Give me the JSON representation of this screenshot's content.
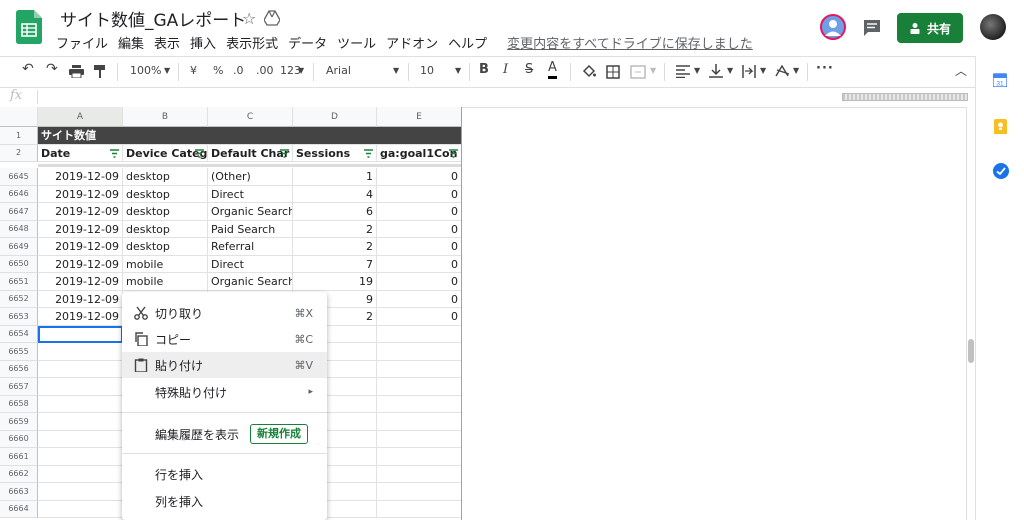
{
  "header": {
    "title": "サイト数値_GAレポート",
    "menu": [
      "ファイル",
      "編集",
      "表示",
      "挿入",
      "表示形式",
      "データ",
      "ツール",
      "アドオン",
      "ヘルプ"
    ],
    "save_status": "変更内容をすべてドライブに保存しました",
    "share_label": "共有",
    "accent_color": "#188038"
  },
  "toolbar": {
    "zoom": "100%",
    "currency": "¥",
    "percent": "%",
    "decimal_decrease": ".0",
    "decimal_increase": ".00",
    "number_format": "123",
    "font": "Arial",
    "font_size": "10"
  },
  "formula": {
    "fx": "fx"
  },
  "sheet": {
    "columns": [
      "A",
      "B",
      "C",
      "D",
      "E"
    ],
    "banner": "サイト数値",
    "headers": [
      "Date",
      "Device Categ",
      "Default Char",
      "Sessions",
      "ga:goal1Con"
    ],
    "header_row_numbers": [
      "1",
      "2"
    ],
    "rows": [
      {
        "n": "6645",
        "date": "2019-12-09",
        "device": "desktop",
        "channel": "(Other)",
        "sessions": "1",
        "goal": "0"
      },
      {
        "n": "6646",
        "date": "2019-12-09",
        "device": "desktop",
        "channel": "Direct",
        "sessions": "4",
        "goal": "0"
      },
      {
        "n": "6647",
        "date": "2019-12-09",
        "device": "desktop",
        "channel": "Organic Search",
        "sessions": "6",
        "goal": "0"
      },
      {
        "n": "6648",
        "date": "2019-12-09",
        "device": "desktop",
        "channel": "Paid Search",
        "sessions": "2",
        "goal": "0"
      },
      {
        "n": "6649",
        "date": "2019-12-09",
        "device": "desktop",
        "channel": "Referral",
        "sessions": "2",
        "goal": "0"
      },
      {
        "n": "6650",
        "date": "2019-12-09",
        "device": "mobile",
        "channel": "Direct",
        "sessions": "7",
        "goal": "0"
      },
      {
        "n": "6651",
        "date": "2019-12-09",
        "device": "mobile",
        "channel": "Organic Search",
        "sessions": "19",
        "goal": "0"
      },
      {
        "n": "6652",
        "date": "2019-12-09",
        "device": "",
        "channel": "",
        "sessions": "9",
        "goal": "0"
      },
      {
        "n": "6653",
        "date": "2019-12-09",
        "device": "",
        "channel": "",
        "sessions": "2",
        "goal": "0"
      },
      {
        "n": "6654",
        "date": "",
        "device": "",
        "channel": "",
        "sessions": "",
        "goal": ""
      },
      {
        "n": "6655",
        "date": "",
        "device": "",
        "channel": "",
        "sessions": "",
        "goal": ""
      },
      {
        "n": "6656",
        "date": "",
        "device": "",
        "channel": "",
        "sessions": "",
        "goal": ""
      },
      {
        "n": "6657",
        "date": "",
        "device": "",
        "channel": "",
        "sessions": "",
        "goal": ""
      },
      {
        "n": "6658",
        "date": "",
        "device": "",
        "channel": "",
        "sessions": "",
        "goal": ""
      },
      {
        "n": "6659",
        "date": "",
        "device": "",
        "channel": "",
        "sessions": "",
        "goal": ""
      },
      {
        "n": "6660",
        "date": "",
        "device": "",
        "channel": "",
        "sessions": "",
        "goal": ""
      },
      {
        "n": "6661",
        "date": "",
        "device": "",
        "channel": "",
        "sessions": "",
        "goal": ""
      },
      {
        "n": "6662",
        "date": "",
        "device": "",
        "channel": "",
        "sessions": "",
        "goal": ""
      },
      {
        "n": "6663",
        "date": "",
        "device": "",
        "channel": "",
        "sessions": "",
        "goal": ""
      },
      {
        "n": "6664",
        "date": "",
        "device": "",
        "channel": "",
        "sessions": "",
        "goal": ""
      }
    ]
  },
  "context_menu": {
    "cut": {
      "label": "切り取り",
      "shortcut": "⌘X"
    },
    "copy": {
      "label": "コピー",
      "shortcut": "⌘C"
    },
    "paste": {
      "label": "貼り付け",
      "shortcut": "⌘V"
    },
    "paste_special": {
      "label": "特殊貼り付け",
      "arrow": "▸"
    },
    "version_history": {
      "label": "編集履歴を表示",
      "badge": "新規作成"
    },
    "insert_row": {
      "label": "行を挿入"
    },
    "insert_column": {
      "label": "列を挿入"
    }
  },
  "side_panel": {
    "calendar_day": "31"
  }
}
